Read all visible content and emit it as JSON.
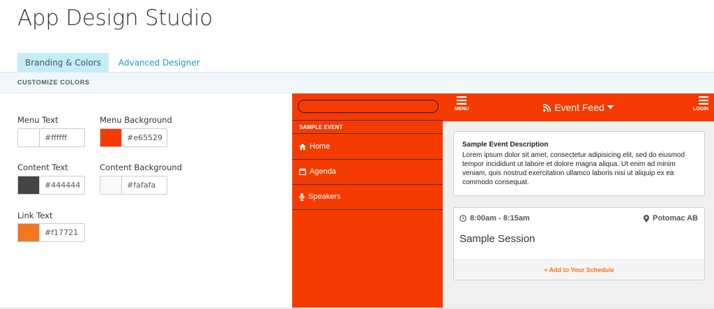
{
  "app": {
    "title": "App Design Studio"
  },
  "tabs": [
    {
      "label": "Branding & Colors",
      "active": true
    },
    {
      "label": "Advanced Designer",
      "active": false
    }
  ],
  "section": {
    "title": "CUSTOMIZE COLORS"
  },
  "colors": {
    "menu_text": {
      "label": "Menu Text",
      "value": "#ffffff"
    },
    "menu_background": {
      "label": "Menu Background",
      "value": "#e65529"
    },
    "content_text": {
      "label": "Content Text",
      "value": "#444444"
    },
    "content_background": {
      "label": "Content Background",
      "value": "#fafafa"
    },
    "link_text": {
      "label": "Link Text",
      "value": "#f17721"
    }
  },
  "preview": {
    "menu": {
      "heading": "SAMPLE EVENT",
      "items": [
        {
          "label": "Home",
          "icon": "home-icon"
        },
        {
          "label": "Agenda",
          "icon": "calendar-icon"
        },
        {
          "label": "Speakers",
          "icon": "microphone-icon"
        }
      ]
    },
    "header": {
      "menu_label": "MENU",
      "title": "Event Feed",
      "login_label": "LOGIN"
    },
    "description": {
      "title": "Sample Event Description",
      "body": "Lorem ipsum dolor sit amet, consectetur adipisicing elit, sed do eiusmod tempor incididunt ut labore et dolore magna aliqua. Ut enim ad minim veniam, quis nostrud exercitation ullamco laboris nisi ut aliquip ex ea commodo consequat."
    },
    "session": {
      "time": "8:00am - 8:15am",
      "location": "Potomac AB",
      "title": "Sample Session",
      "action": "Add to Your Schedule"
    }
  }
}
